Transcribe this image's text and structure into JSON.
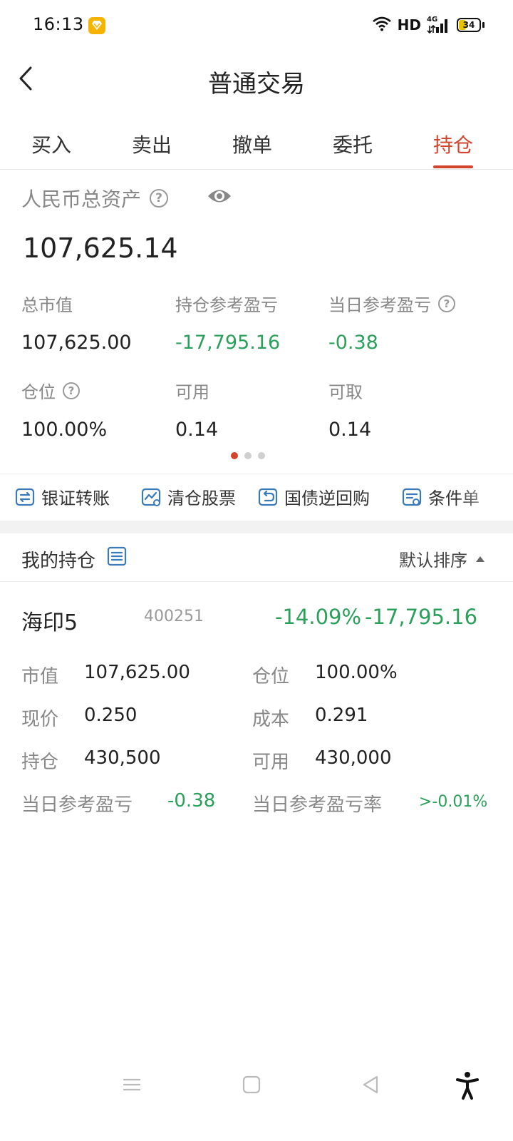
{
  "status_bar": {
    "time": "16:13",
    "network_label": "HD",
    "network_type": "4G",
    "battery_level": "34",
    "icons": [
      "app-notification-icon",
      "wifi-icon",
      "cellular-signal-icon",
      "battery-icon"
    ]
  },
  "nav": {
    "title": "普通交易",
    "back_icon": "back-chevron-icon"
  },
  "tabs": [
    {
      "label": "买入",
      "active": false
    },
    {
      "label": "卖出",
      "active": false
    },
    {
      "label": "撤单",
      "active": false
    },
    {
      "label": "委托",
      "active": false
    },
    {
      "label": "持仓",
      "active": true
    }
  ],
  "assets": {
    "title": "人民币总资产",
    "total": "107,625.14",
    "metrics": [
      {
        "label": "总市值",
        "value": "107,625.00",
        "help": false,
        "green": false
      },
      {
        "label": "持仓参考盈亏",
        "value": "-17,795.16",
        "help": false,
        "green": true
      },
      {
        "label": "当日参考盈亏",
        "value": "-0.38",
        "help": true,
        "green": true
      },
      {
        "label": "仓位",
        "value": "100.00%",
        "help": true,
        "green": false
      },
      {
        "label": "可用",
        "value": "0.14",
        "help": false,
        "green": false
      },
      {
        "label": "可取",
        "value": "0.14",
        "help": false,
        "green": false
      }
    ],
    "carousel_pages": 3,
    "carousel_active": 1
  },
  "quick_actions": [
    {
      "label": "银证转账",
      "icon": "bank-transfer-icon"
    },
    {
      "label": "清仓股票",
      "icon": "clear-stock-icon"
    },
    {
      "label": "国债逆回购",
      "icon": "bond-repo-icon"
    },
    {
      "label": "条件单",
      "icon": "condition-order-icon"
    }
  ],
  "holdings": {
    "title": "我的持仓",
    "sort_label": "默认排序",
    "items": [
      {
        "name": "海印5",
        "code": "400251",
        "pct": "-14.09%",
        "pnl": "-17,795.16",
        "fields": {
          "market_value_label": "市值",
          "market_value": "107,625.00",
          "position_ratio_label": "仓位",
          "position_ratio": "100.00%",
          "price_label": "现价",
          "price": "0.250",
          "cost_label": "成本",
          "cost": "0.291",
          "holding_label": "持仓",
          "holding": "430,500",
          "available_label": "可用",
          "available": "430,000",
          "day_pnl_label": "当日参考盈亏",
          "day_pnl": "-0.38",
          "day_pnl_rate_label": "当日参考盈亏率",
          "day_pnl_rate": ">-0.01%"
        }
      }
    ]
  },
  "colors": {
    "accent": "#d2452c",
    "profit_loss_green": "#2aa05a",
    "label_gray": "#888888",
    "icon_blue": "#3a7ab8"
  }
}
